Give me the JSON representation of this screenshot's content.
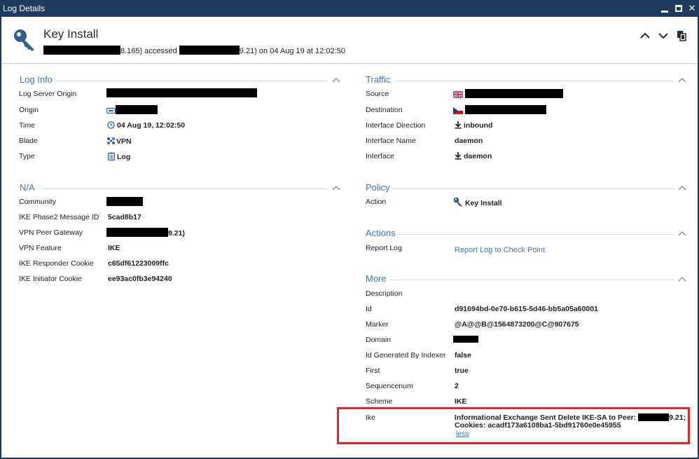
{
  "window": {
    "title": "Log Details"
  },
  "header": {
    "title": "Key Install",
    "subtitle_part1": "8.165) accessed",
    "subtitle_part2": "9.21) on 04 Aug 19 at  12:02:50"
  },
  "log_info": {
    "title": "Log Info",
    "rows": [
      {
        "label": "Log Server Origin",
        "value": ""
      },
      {
        "label": "Origin",
        "value": ""
      },
      {
        "label": "Time",
        "value": "04 Aug 19, 12:02:50"
      },
      {
        "label": "Blade",
        "value": "VPN"
      },
      {
        "label": "Type",
        "value": "Log"
      }
    ]
  },
  "na": {
    "title": "N/A",
    "rows": [
      {
        "label": "Community",
        "value": ""
      },
      {
        "label": "IKE Phase2 Message ID",
        "value": "5cad8b17"
      },
      {
        "label": "VPN Peer Gateway",
        "value": "9.21)"
      },
      {
        "label": "VPN Feature",
        "value": "IKE"
      },
      {
        "label": "IKE Responder Cookie",
        "value": "c65df61223009ffc"
      },
      {
        "label": "IKE Initiator Cookie",
        "value": "ee93ac0fb3e94240"
      }
    ]
  },
  "traffic": {
    "title": "Traffic",
    "rows": [
      {
        "label": "Source",
        "value": ""
      },
      {
        "label": "Destination",
        "value": ""
      },
      {
        "label": "Interface Direction",
        "value": "inbound"
      },
      {
        "label": "Interface Name",
        "value": "daemon"
      },
      {
        "label": "Interface",
        "value": "daemon"
      }
    ]
  },
  "policy": {
    "title": "Policy",
    "rows": [
      {
        "label": "Action",
        "value": "Key Install"
      }
    ]
  },
  "actions": {
    "title": "Actions",
    "rows": [
      {
        "label": "Report Log",
        "link": "Report Log to Check Point"
      }
    ]
  },
  "more": {
    "title": "More",
    "rows": [
      {
        "label": "Description",
        "value": ""
      },
      {
        "label": "Id",
        "value": "d91694bd-0e70-b615-5d46-bb5a05a60001"
      },
      {
        "label": "Marker",
        "value": "@A@@B@1564873200@C@907675"
      },
      {
        "label": "Domain",
        "value": ""
      },
      {
        "label": "Id Generated By Indexer",
        "value": "false"
      },
      {
        "label": "First",
        "value": "true"
      },
      {
        "label": "Sequencenum",
        "value": "2"
      },
      {
        "label": "Scheme",
        "value": "IKE"
      },
      {
        "label": "Ike",
        "value_line1_a": "Informational Exchange Sent Delete IKE-SA to Peer:",
        "value_line1_b": "9.21;",
        "value_line2": "Cookies: acadf173a6108ba1-5bd91760e0e45955",
        "less": "less"
      }
    ]
  },
  "colors": {
    "accent": "#3a78c3",
    "titlebar": "#1e3a5f",
    "highlight": "#e8242b"
  }
}
